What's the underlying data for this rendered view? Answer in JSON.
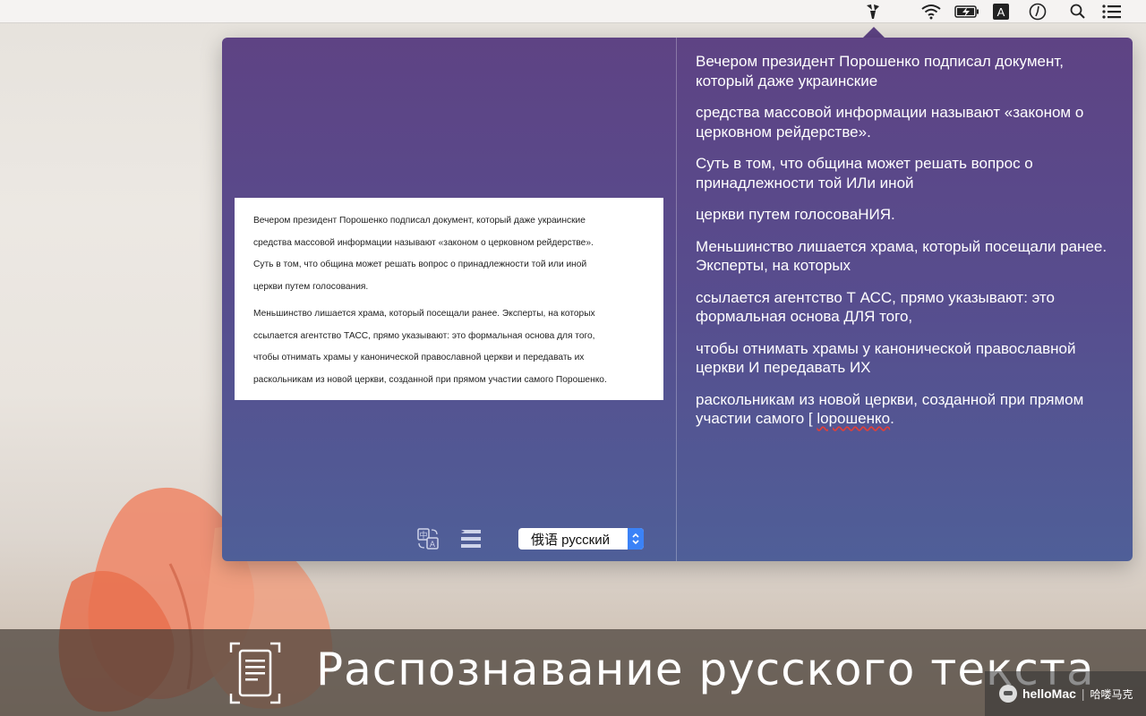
{
  "menubar": {
    "icons": [
      "translator-app-icon",
      "wifi-icon",
      "battery-icon",
      "input-source-icon",
      "clock-icon",
      "spotlight-search-icon",
      "notification-center-icon"
    ],
    "input_source_letter": "A"
  },
  "popover": {
    "source_document": {
      "paragraphs": [
        [
          "Вечером президент Порошенко подписал документ, который даже украинские",
          "средства массовой информации называют «законом о церковном рейдерстве».",
          "Суть в том, что община может решать вопрос о принадлежности той или иной",
          "церкви путем голосования."
        ],
        [
          "Меньшинство лишается храма, который посещали ранее. Эксперты, на которых",
          "ссылается агентство ТАСС, прямо указывают: это формальная основа для того,",
          "чтобы отнимать храмы у канонической православной церкви и передавать их",
          "раскольникам из новой церкви, созданной при прямом участии самого Порошенко."
        ]
      ]
    },
    "toolbar": {
      "translate_icon": "translate-icon",
      "list_icon": "list-icon",
      "language_select": {
        "value": "俄语 русский"
      }
    },
    "recognized_text": {
      "p1": "Вечером президент Порошенко подписал документ, который даже украинские",
      "p2": "средства массовой информации называют «законом о церковном рейдерстве».",
      "p3": "Суть в том, что община может решать вопрос о принадлежности той ИЛи иной",
      "p4": "церкви путем голосоваНИЯ.",
      "p5": "Меньшинство лишается храма, который посещали ранее. Эксперты, на которых",
      "p6": "ссылается агентство Т АСС, прямо указывают: это формальная основа ДЛЯ того,",
      "p7": "чтобы отнимать храмы у канонической православной церкви И передавать ИХ",
      "p8_main": "раскольникам из новой церкви, созданной при прямом участии самого [ ",
      "p8_err": "lорошенко",
      "p8_end": "."
    }
  },
  "banner": {
    "caption": "Распознавание русского текста",
    "icon": "document-scan-icon"
  },
  "watermark": {
    "brand": "helloMac",
    "separator": "|",
    "chinese": "哈喽马克"
  },
  "colors": {
    "popover_top": "#5e4384",
    "popover_bottom": "#4f5f98",
    "select_stepper": "#3b82f7",
    "spellcheck": "#e0403a"
  }
}
